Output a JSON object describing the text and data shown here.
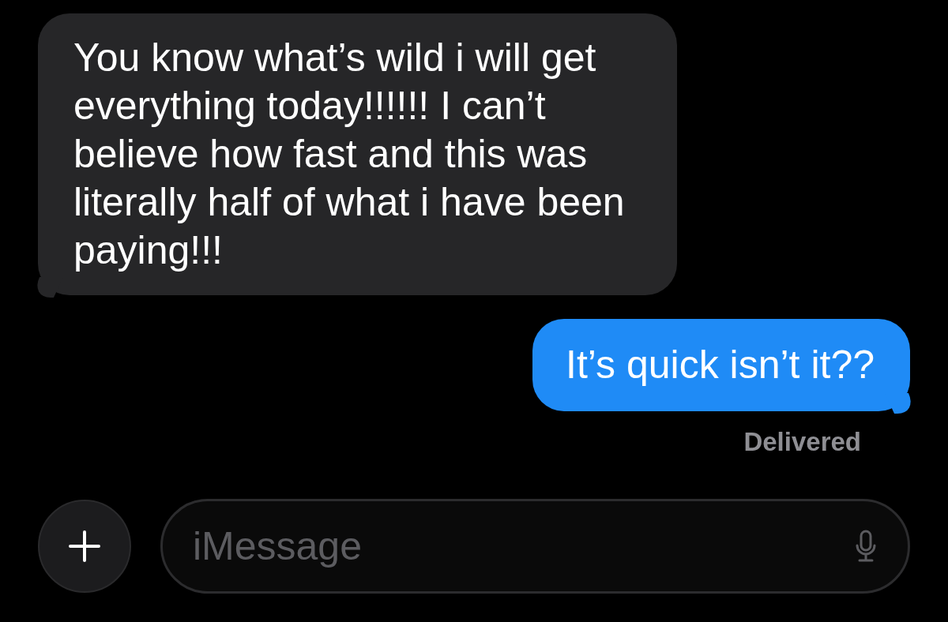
{
  "messages": [
    {
      "kind": "received",
      "text": "You know what’s wild i will get everything today!!!!!! I can’t believe how fast and this was literally half of what i have been paying!!!"
    },
    {
      "kind": "sent",
      "text": "It’s quick isn’t it??"
    }
  ],
  "status": "Delivered",
  "composer": {
    "placeholder": "iMessage"
  }
}
